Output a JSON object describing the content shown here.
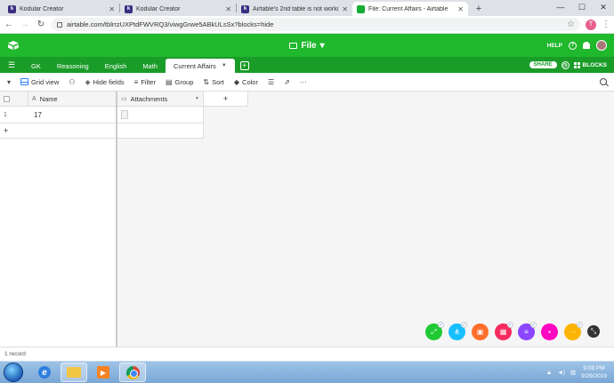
{
  "browser": {
    "tabs": [
      {
        "title": "Kodular Creator",
        "favicon": "k-icon"
      },
      {
        "title": "Kodular Creator",
        "favicon": "k-icon"
      },
      {
        "title": "Airtable's 2nd table is not workin",
        "favicon": "k-icon"
      },
      {
        "title": "File: Current Affairs - Airtable",
        "favicon": "airtable-icon"
      }
    ],
    "new_tab": "+",
    "window_controls": [
      "—",
      "☐",
      "✕"
    ],
    "url": "airtable.com/tblrrzUXPtdFWVRQ3/viwgGrwe5ABkULsSx?blocks=hide",
    "profile_initial": "T"
  },
  "app": {
    "base_name": "File",
    "help": "HELP",
    "share": "SHARE",
    "blocks": "BLOCKS",
    "accent": "#20b82d"
  },
  "tables": [
    {
      "label": "GK"
    },
    {
      "label": "Reasoning"
    },
    {
      "label": "English"
    },
    {
      "label": "Math"
    },
    {
      "label": "Current Affairs",
      "active": true
    }
  ],
  "view": {
    "name": "Grid view",
    "hide_fields": "Hide fields",
    "filter": "Filter",
    "group": "Group",
    "sort": "Sort",
    "color": "Color",
    "more": "···"
  },
  "grid": {
    "columns": [
      {
        "name": "Name",
        "icon": "text-field-icon"
      },
      {
        "name": "Attachments",
        "icon": "attachment-field-icon"
      }
    ],
    "add_column": "+",
    "rows": [
      {
        "num": "1",
        "name": "17"
      }
    ],
    "add_row": "+"
  },
  "footer": {
    "record_count": "1 record"
  },
  "dock": [
    {
      "color": "#20c933",
      "icon": "expand-icon"
    },
    {
      "color": "#18bfff",
      "icon": "share-icon"
    },
    {
      "color": "#ff6f2c",
      "icon": "calendar-icon"
    },
    {
      "color": "#f82b60",
      "icon": "grid-icon"
    },
    {
      "color": "#8b46ff",
      "icon": "list-icon"
    },
    {
      "color": "#ff08c2",
      "icon": "chat-icon"
    },
    {
      "color": "#fcb400",
      "icon": "more-icon"
    },
    {
      "color": "#333333",
      "icon": "collapse-icon"
    }
  ],
  "taskbar": {
    "time": "9:08 PM",
    "date": "9/29/2019"
  }
}
